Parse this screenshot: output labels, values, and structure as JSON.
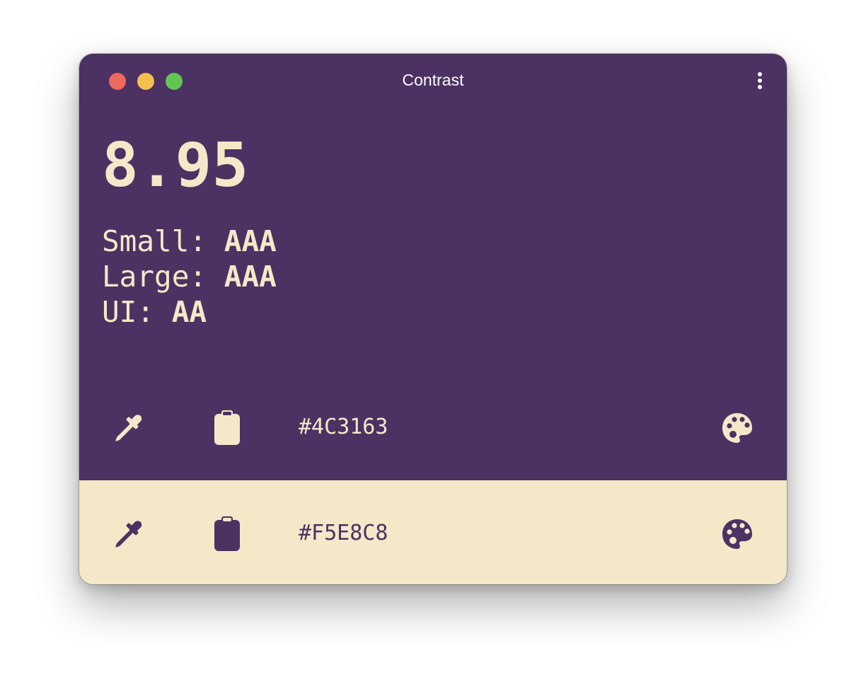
{
  "window": {
    "title": "Contrast"
  },
  "result": {
    "ratio": "8.95",
    "levels": [
      {
        "label": "Small: ",
        "value": "AAA"
      },
      {
        "label": "Large: ",
        "value": "AAA"
      },
      {
        "label": "UI: ",
        "value": "AA"
      }
    ]
  },
  "foreground": {
    "hex": "#4C3163",
    "picker_icon": "eyedropper-icon",
    "paste_icon": "clipboard-icon",
    "palette_icon": "palette-icon"
  },
  "background": {
    "hex": "#F5E8C8",
    "picker_icon": "eyedropper-icon",
    "paste_icon": "clipboard-icon",
    "palette_icon": "palette-icon"
  },
  "colors": {
    "dark": "#4C3163",
    "light": "#F5E8C8",
    "close": "#EC6A5E",
    "minimize": "#F4BF4F",
    "maximize": "#61C554"
  }
}
